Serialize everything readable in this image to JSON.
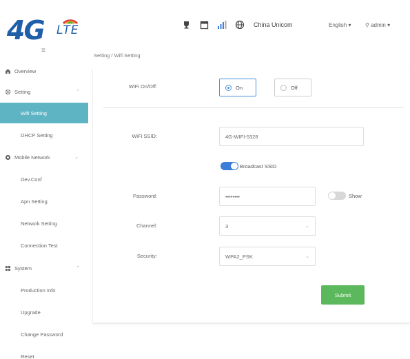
{
  "brand": {
    "logo_text": "4G",
    "logo_suffix": "LTE"
  },
  "topbar": {
    "icons": [
      "trophy-icon",
      "sim-card-icon",
      "signal-icon",
      "globe-icon"
    ],
    "carrier": "China Unicom",
    "language": "English ▾",
    "user": "⚲ admin ▾"
  },
  "menu_toggle": "≡",
  "breadcrumb": "Setting / Wifi Setting",
  "sidebar": {
    "items": [
      {
        "label": "Overview",
        "icon": "home-icon"
      },
      {
        "label": "Setting",
        "icon": "gear-icon",
        "chevron": "⌃"
      },
      {
        "label": "Wifi Setting",
        "active": true
      },
      {
        "label": "DHCP Setting"
      },
      {
        "label": "Mobile Network",
        "icon": "network-icon",
        "chevron": "⌄"
      },
      {
        "label": "Dev.Conf"
      },
      {
        "label": "Apn Setting"
      },
      {
        "label": "Network Setting"
      },
      {
        "label": "Connection Test"
      },
      {
        "label": "System",
        "icon": "system-icon",
        "chevron": "⌃"
      },
      {
        "label": "Production Info"
      },
      {
        "label": "Upgrade"
      },
      {
        "label": "Change Password"
      },
      {
        "label": "Reset"
      }
    ]
  },
  "form": {
    "wifi_label": "WiFi On/Off:",
    "wifi_on": "On",
    "wifi_off": "Off",
    "wifi_state": "On",
    "ssid_label": "WiFi SSID:",
    "ssid_value": "4G-WIFI-5328",
    "broadcast_label": "Broadcast SSID",
    "broadcast_enabled": true,
    "password_label": "Password:",
    "password_value": "••••••••",
    "show_label": "Show",
    "show_enabled": false,
    "channel_label": "Channel:",
    "channel_value": "3",
    "security_label": "Security:",
    "security_value": "WPA2_PSK",
    "submit_label": "Submit"
  },
  "colors": {
    "accent": "#5fb4c4",
    "brand": "#1e5fa8",
    "submit": "#5cb85c",
    "toggle_on": "#3a7ed8"
  }
}
